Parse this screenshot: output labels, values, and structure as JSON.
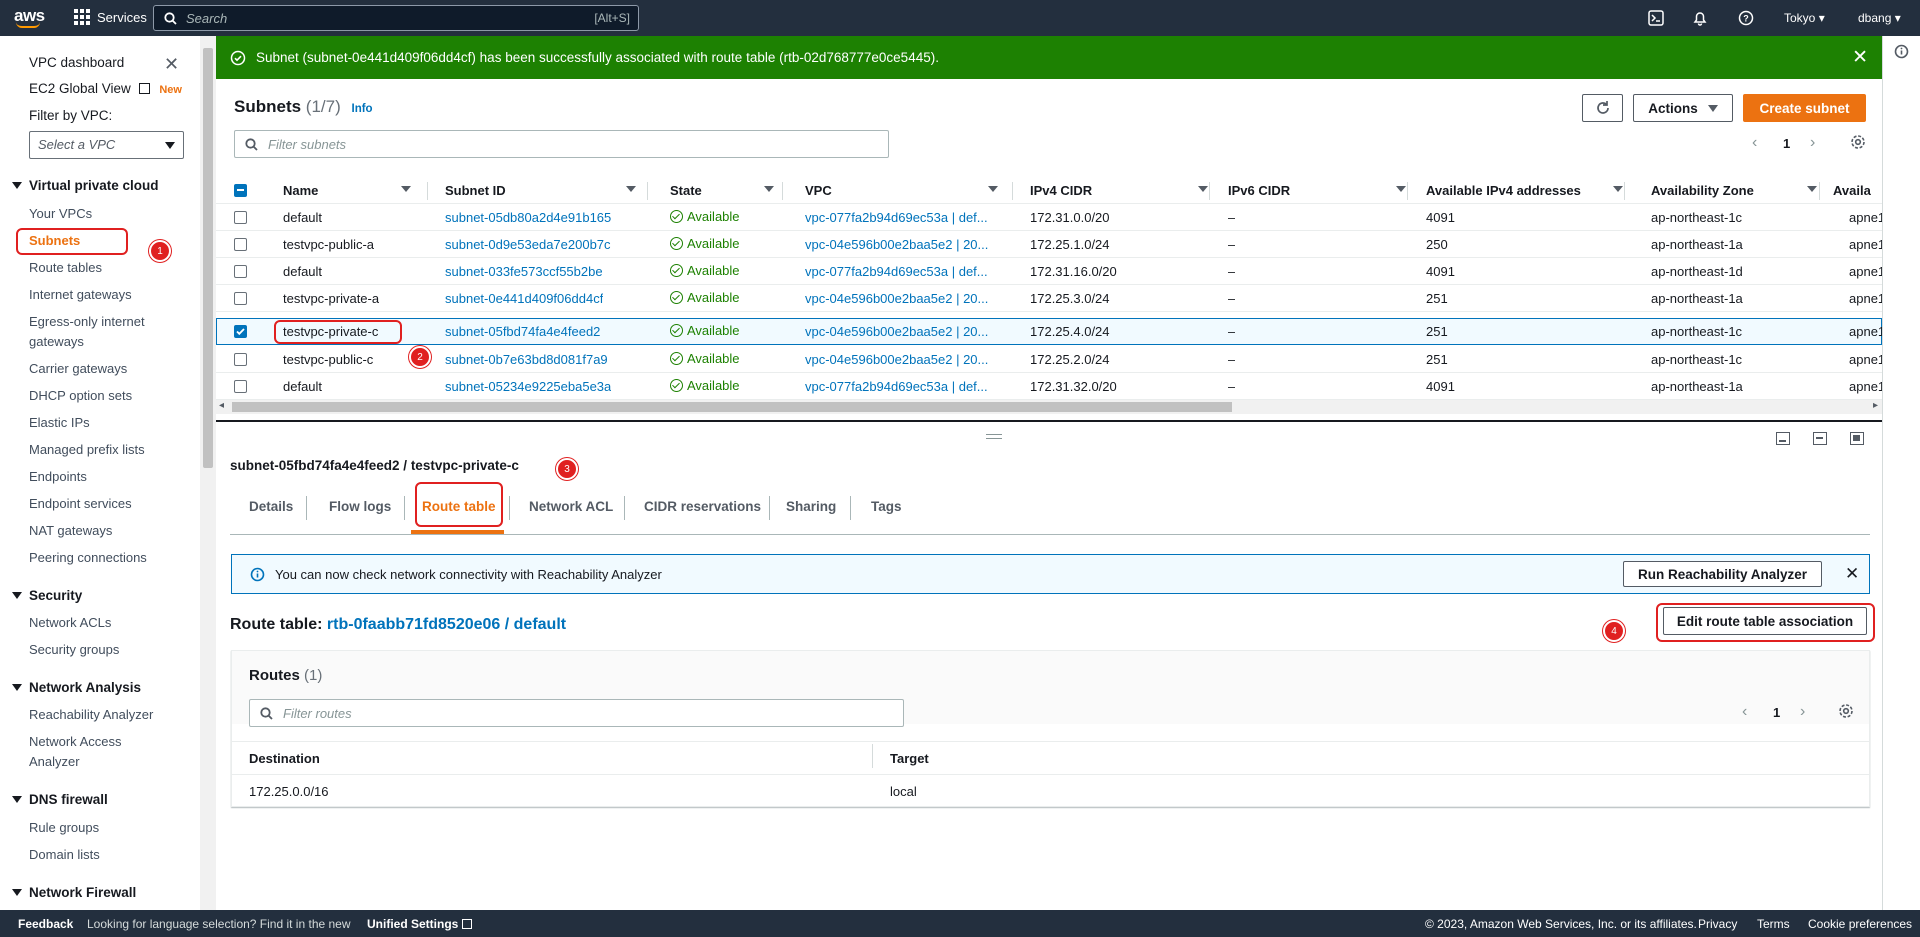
{
  "topnav": {
    "logo": "aws",
    "services_label": "Services",
    "search_placeholder": "Search",
    "search_shortcut": "[Alt+S]",
    "region": "Tokyo",
    "user": "dbang"
  },
  "flash": {
    "message": "Subnet (subnet-0e441d409f06dd4cf) has been successfully associated with route table (rtb-02d768777e0ce5445)."
  },
  "sidebar": {
    "top_items": [
      {
        "label": "VPC dashboard"
      },
      {
        "label": "EC2 Global View",
        "tag": "New"
      }
    ],
    "filter_label": "Filter by VPC:",
    "filter_placeholder": "Select a VPC",
    "sections": [
      {
        "title": "Virtual private cloud",
        "items": [
          "Your VPCs",
          "Subnets",
          "Route tables",
          "Internet gateways",
          "Egress-only internet",
          "gateways",
          "Carrier gateways",
          "DHCP option sets",
          "Elastic IPs",
          "Managed prefix lists",
          "Endpoints",
          "Endpoint services",
          "NAT gateways",
          "Peering connections"
        ]
      },
      {
        "title": "Security",
        "items": [
          "Network ACLs",
          "Security groups"
        ]
      },
      {
        "title": "Network Analysis",
        "items": [
          "Reachability Analyzer",
          "Network Access",
          "Analyzer"
        ]
      },
      {
        "title": "DNS firewall",
        "items": [
          "Rule groups",
          "Domain lists"
        ]
      },
      {
        "title": "Network Firewall",
        "items": []
      }
    ]
  },
  "subnets": {
    "title": "Subnets",
    "count": "(1/7)",
    "info": "Info",
    "actions_label": "Actions",
    "create_label": "Create subnet",
    "filter_placeholder": "Filter subnets",
    "page": "1",
    "columns": [
      "Name",
      "Subnet ID",
      "State",
      "VPC",
      "IPv4 CIDR",
      "IPv6 CIDR",
      "Available IPv4 addresses",
      "Availability Zone",
      "Availa"
    ],
    "rows": [
      {
        "name": "default",
        "id": "subnet-05db80a2d4e91b165",
        "state": "Available",
        "vpc": "vpc-077fa2b94d69ec53a | def...",
        "ipv4": "172.31.0.0/20",
        "ipv6": "–",
        "avail": "4091",
        "az": "ap-northeast-1c",
        "azid": "apne1"
      },
      {
        "name": "testvpc-public-a",
        "id": "subnet-0d9e53eda7e200b7c",
        "state": "Available",
        "vpc": "vpc-04e596b00e2baa5e2 | 20...",
        "ipv4": "172.25.1.0/24",
        "ipv6": "–",
        "avail": "250",
        "az": "ap-northeast-1a",
        "azid": "apne1"
      },
      {
        "name": "default",
        "id": "subnet-033fe573ccf55b2be",
        "state": "Available",
        "vpc": "vpc-077fa2b94d69ec53a | def...",
        "ipv4": "172.31.16.0/20",
        "ipv6": "–",
        "avail": "4091",
        "az": "ap-northeast-1d",
        "azid": "apne1"
      },
      {
        "name": "testvpc-private-a",
        "id": "subnet-0e441d409f06dd4cf",
        "state": "Available",
        "vpc": "vpc-04e596b00e2baa5e2 | 20...",
        "ipv4": "172.25.3.0/24",
        "ipv6": "–",
        "avail": "251",
        "az": "ap-northeast-1a",
        "azid": "apne1"
      },
      {
        "name": "testvpc-private-c",
        "id": "subnet-05fbd74fa4e4feed2",
        "state": "Available",
        "vpc": "vpc-04e596b00e2baa5e2 | 20...",
        "ipv4": "172.25.4.0/24",
        "ipv6": "–",
        "avail": "251",
        "az": "ap-northeast-1c",
        "azid": "apne1",
        "selected": true
      },
      {
        "name": "testvpc-public-c",
        "id": "subnet-0b7e63bd8d081f7a9",
        "state": "Available",
        "vpc": "vpc-04e596b00e2baa5e2 | 20...",
        "ipv4": "172.25.2.0/24",
        "ipv6": "–",
        "avail": "251",
        "az": "ap-northeast-1c",
        "azid": "apne1"
      },
      {
        "name": "default",
        "id": "subnet-05234e9225eba5e3a",
        "state": "Available",
        "vpc": "vpc-077fa2b94d69ec53a | def...",
        "ipv4": "172.31.32.0/20",
        "ipv6": "–",
        "avail": "4091",
        "az": "ap-northeast-1a",
        "azid": "apne1"
      }
    ]
  },
  "detail": {
    "heading": "subnet-05fbd74fa4e4feed2 / testvpc-private-c",
    "tabs": [
      "Details",
      "Flow logs",
      "Route table",
      "Network ACL",
      "CIDR reservations",
      "Sharing",
      "Tags"
    ],
    "banner_text": "You can now check network connectivity with Reachability Analyzer",
    "banner_button": "Run Reachability Analyzer",
    "route_table_label": "Route table:",
    "route_table_value": "rtb-0faabb71fd8520e06 / default",
    "edit_button": "Edit route table association",
    "routes_title": "Routes",
    "routes_count": "(1)",
    "routes_filter": "Filter routes",
    "routes_page": "1",
    "routes_columns": [
      "Destination",
      "Target"
    ],
    "routes_rows": [
      {
        "destination": "172.25.0.0/16",
        "target": "local"
      }
    ]
  },
  "annotations": [
    "1",
    "2",
    "3",
    "4"
  ],
  "footer": {
    "feedback": "Feedback",
    "lang_text": "Looking for language selection? Find it in the new",
    "unified": "Unified Settings",
    "copyright": "© 2023, Amazon Web Services, Inc. or its affiliates.",
    "privacy": "Privacy",
    "terms": "Terms",
    "cookies": "Cookie preferences"
  },
  "colors": {
    "nav": "#232f3e",
    "success": "#1d8102",
    "primary": "#ec7211",
    "link": "#0073bb",
    "annotation": "#e02020"
  }
}
